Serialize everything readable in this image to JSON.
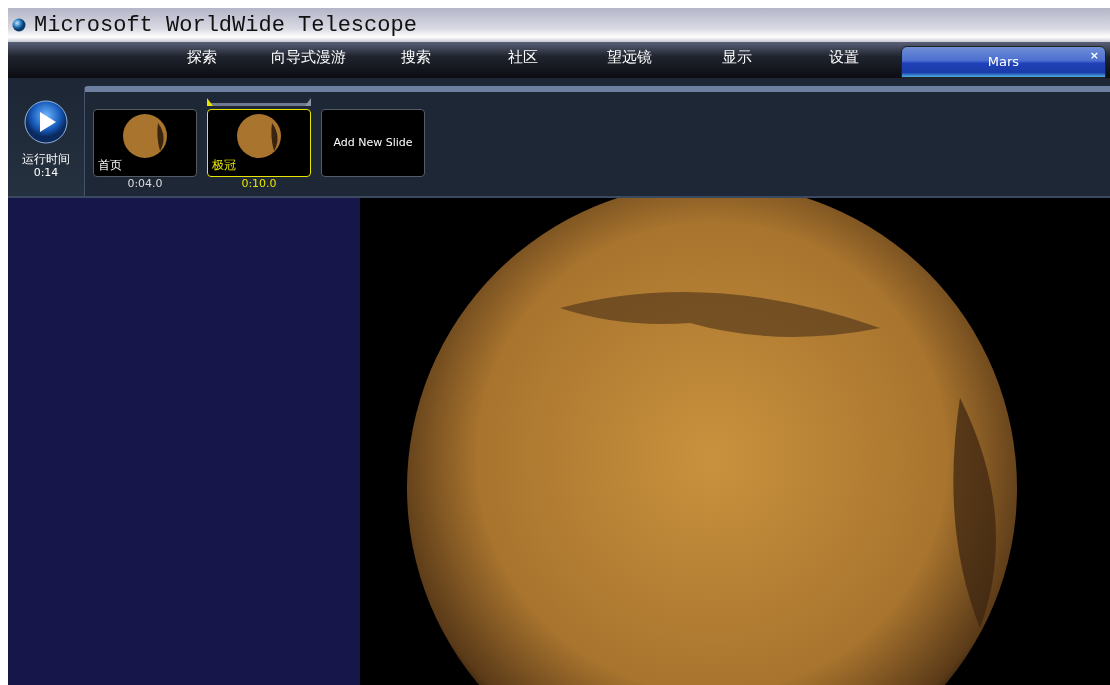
{
  "window": {
    "title": "Microsoft WorldWide Telescope"
  },
  "menu_tabs": [
    {
      "label": "探索",
      "selected": false
    },
    {
      "label": "向导式漫游",
      "selected": false
    },
    {
      "label": "搜索",
      "selected": false
    },
    {
      "label": "社区",
      "selected": false
    },
    {
      "label": "望远镜",
      "selected": false
    },
    {
      "label": "显示",
      "selected": false
    },
    {
      "label": "设置",
      "selected": false
    },
    {
      "label": "Mars",
      "selected": true,
      "close_glyph": "×"
    }
  ],
  "tour": {
    "play_label": "运行时间",
    "run_time": "0:14",
    "slides": [
      {
        "title": "首页",
        "duration": "0:04.0",
        "selected": false
      },
      {
        "title": "极冠",
        "duration": "0:10.0",
        "selected": true
      }
    ],
    "add_slide": "Add New Slide"
  }
}
